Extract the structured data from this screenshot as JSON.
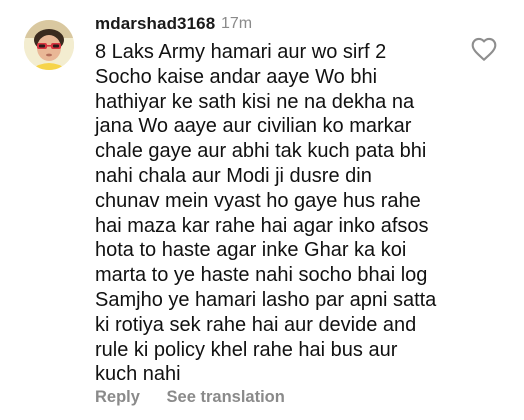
{
  "comment": {
    "username": "mdarshad3168",
    "timestamp": "17m",
    "lines": [
      "8 Laks Army hamari aur wo sirf 2",
      "Socho kaise andar aaye Wo bhi",
      "hathiyar ke sath kisi ne na dekha na",
      "jana Wo aaye aur civilian ko markar",
      "chale gaye aur abhi tak kuch pata bhi",
      "nahi chala aur Modi ji dusre din",
      "chunav mein vyast ho gaye hus rahe",
      "hai maza kar rahe hai agar inko afsos",
      "hota to haste agar inke Ghar ka koi",
      "marta to ye haste nahi socho bhai log",
      "Samjho ye hamari lasho par apni satta",
      "ki rotiya sek rahe hai aur devide and",
      "rule ki policy khel rahe hai bus aur",
      "kuch nahi"
    ],
    "actions": {
      "reply": "Reply",
      "see_translation": "See translation"
    },
    "icons": {
      "like": "heart-outline-icon",
      "avatar": "child-with-sunglasses-avatar"
    },
    "colors": {
      "text": "#111111",
      "muted": "#8a8a8a"
    }
  }
}
